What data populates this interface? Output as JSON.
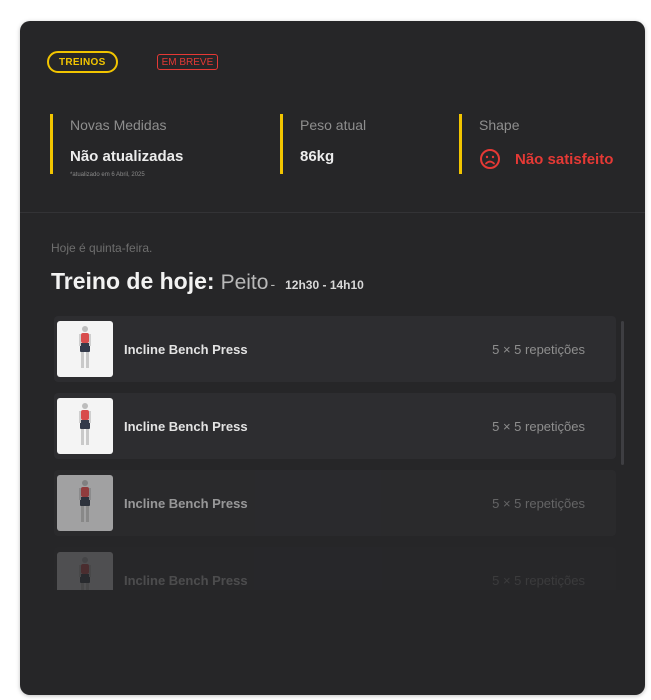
{
  "tabs": {
    "active": "TREINOS",
    "soon": "EM BREVE"
  },
  "stats": {
    "measures": {
      "label": "Novas Medidas",
      "value": "Não atualizadas",
      "note": "*atualizado em 6 Abril, 2025"
    },
    "weight": {
      "label": "Peso atual",
      "value": "86kg"
    },
    "shape": {
      "label": "Shape",
      "value": "Não satisfeito",
      "icon": "sad-face-icon"
    }
  },
  "today": {
    "day_text": "Hoje é quinta-feira.",
    "label": "Treino de hoje:",
    "group": "Peito",
    "dash": "-",
    "time": "12h30 - 14h10"
  },
  "exercises": [
    {
      "name": "Incline Bench Press",
      "reps": "5 × 5 repetições"
    },
    {
      "name": "Incline Bench Press",
      "reps": "5 × 5 repetições"
    },
    {
      "name": "Incline Bench Press",
      "reps": "5 × 5 repetições"
    },
    {
      "name": "Incline Bench Press",
      "reps": "5 × 5 repetições"
    }
  ],
  "colors": {
    "accent": "#f2c500",
    "danger": "#e53935",
    "card": "#262628",
    "row": "#2d2d30"
  }
}
